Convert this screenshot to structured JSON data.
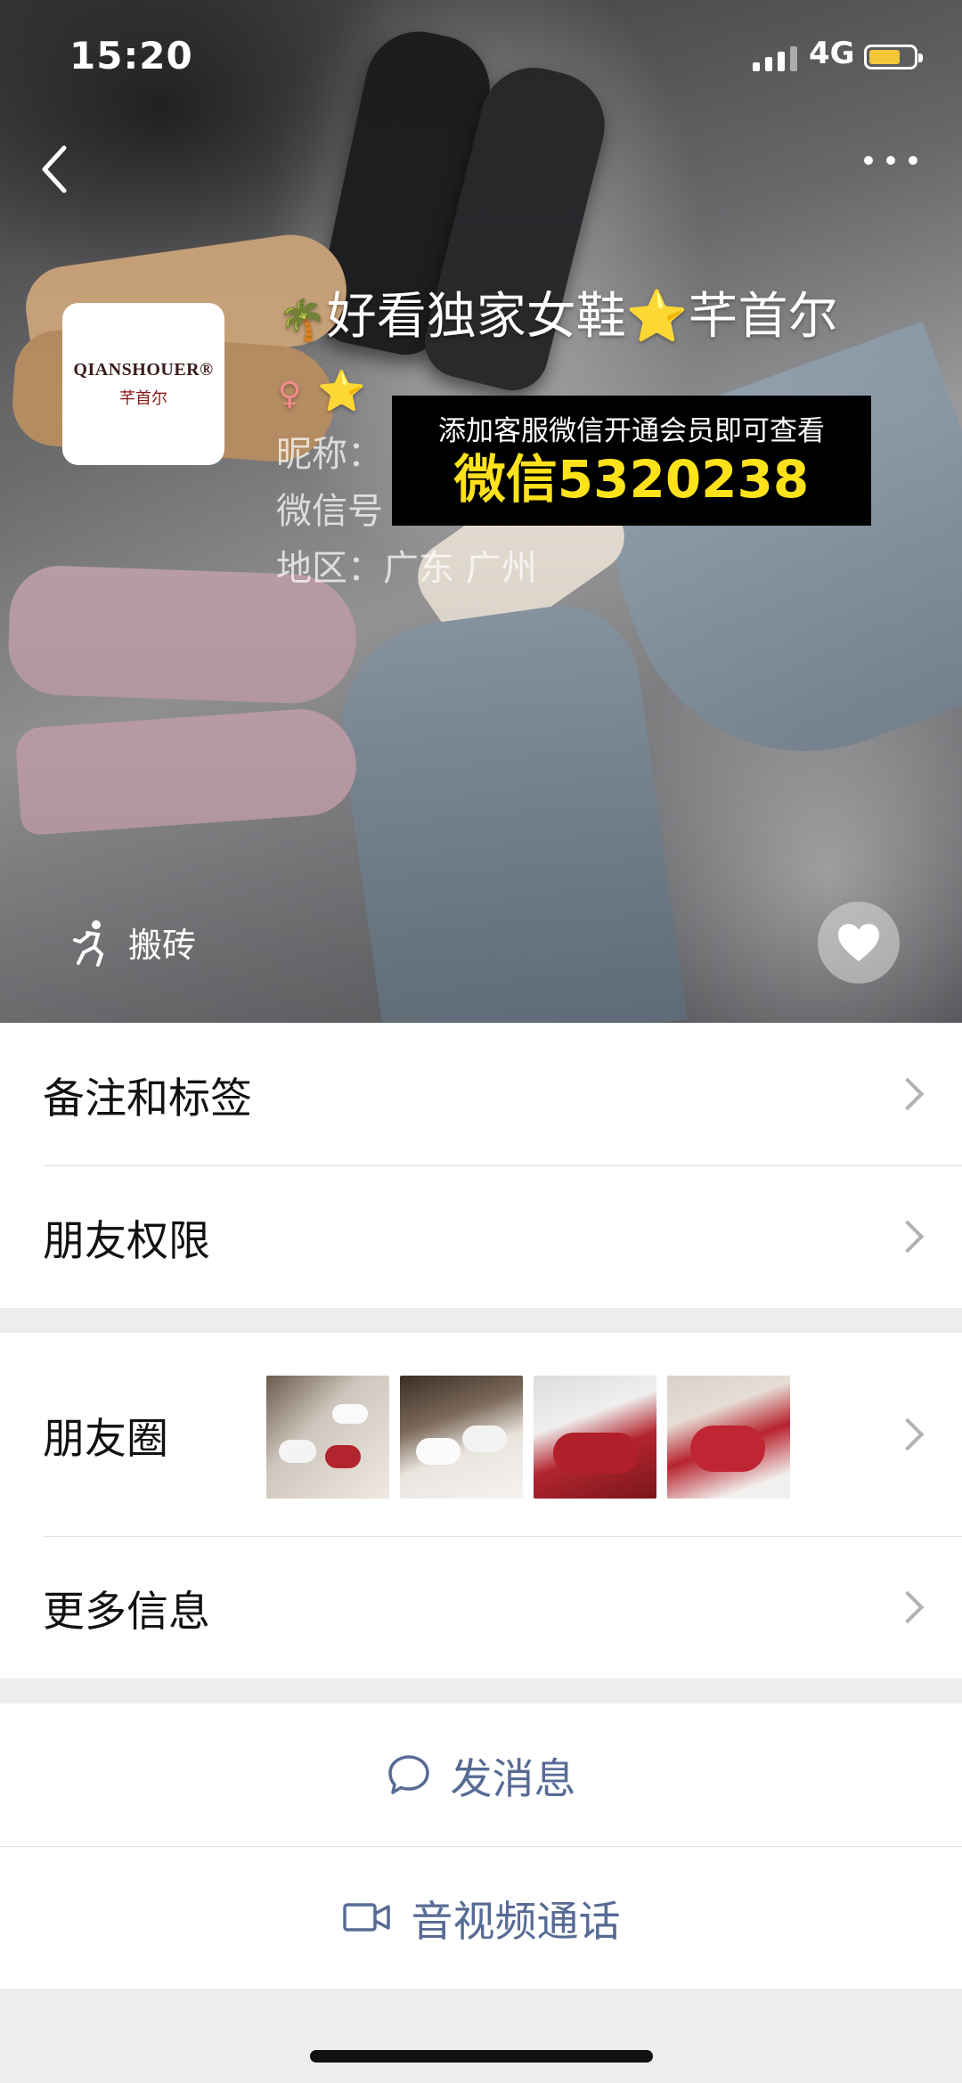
{
  "status_bar": {
    "time": "15:20",
    "network": "4G"
  },
  "profile": {
    "avatar_brand": "QIANSHOUER®",
    "avatar_brand_cn": "芊首尔",
    "name": "好看独家女鞋⭐芊首尔",
    "name_emoji_prefix": "🌴",
    "gender_icon": "female-icon",
    "name_suffix_emoji": "⭐",
    "nickname_label": "昵称：",
    "wechat_id_label": "微信号",
    "region_label": "地区：广东 广州"
  },
  "banner": {
    "line1": "添加客服微信开通会员即可查看",
    "line2": "微信5320238"
  },
  "hero": {
    "status_label": "搬砖",
    "like_icon": "heart-icon"
  },
  "menu": {
    "remark_tags": "备注和标签",
    "friend_permissions": "朋友权限",
    "moments": "朋友圈",
    "more_info": "更多信息"
  },
  "actions": {
    "send_message": "发消息",
    "av_call": "音视频通话"
  },
  "colors": {
    "link_blue": "#576b95",
    "banner_yellow": "#ffe21a",
    "battery": "#f2c83a"
  }
}
